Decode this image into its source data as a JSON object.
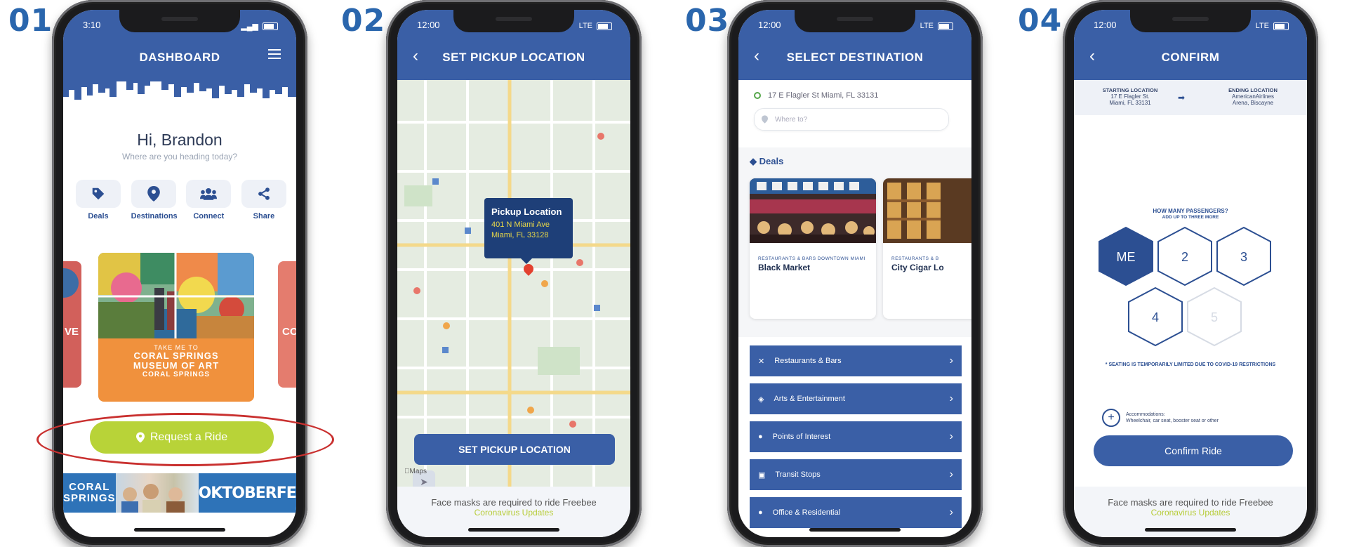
{
  "steps": [
    "01",
    "02",
    "03",
    "04"
  ],
  "phone1": {
    "time": "3:10",
    "title": "DASHBOARD",
    "greeting": "Hi, Brandon",
    "subtitle": "Where are you heading today?",
    "quick_actions": [
      {
        "label": "Deals",
        "icon": "tag-icon"
      },
      {
        "label": "Destinations",
        "icon": "location-pin-icon"
      },
      {
        "label": "Connect",
        "icon": "people-icon"
      },
      {
        "label": "Share",
        "icon": "share-icon"
      }
    ],
    "card": {
      "line1": "TAKE ME TO",
      "line2": "CORAL SPRINGS",
      "line3": "MUSEUM OF ART",
      "line4": "CORAL SPRINGS"
    },
    "left_peek": "VE",
    "right_peek": "CO",
    "request_button": "Request a Ride",
    "banner": {
      "left": "CORAL\nSPRINGS",
      "right": "OKTOBERFEST"
    }
  },
  "phone2": {
    "time": "12:00",
    "signal": "LTE",
    "title": "SET PICKUP LOCATION",
    "callout_title": "Pickup Location",
    "callout_line1": "401 N Miami Ave",
    "callout_line2": "Miami, FL 33128",
    "pickup_button": "SET PICKUP LOCATION",
    "maps_label": "Maps",
    "footer_line1": "Face masks are required to ride Freebee",
    "footer_line2": "Coronavirus Updates"
  },
  "phone3": {
    "time": "12:00",
    "signal": "LTE",
    "title": "SELECT DESTINATION",
    "from": "17 E Flagler St  Miami, FL 33131",
    "where_placeholder": "Where to?",
    "deals_title": "Deals",
    "deals": [
      {
        "tag": "RESTAURANTS & BARS    DOWNTOWN MIAMI",
        "name": "Black Market"
      },
      {
        "tag": "RESTAURANTS & B",
        "name": "City Cigar Lo"
      }
    ],
    "categories": [
      {
        "label": "Restaurants & Bars",
        "icon": "fork-knife-icon"
      },
      {
        "label": "Arts & Entertainment",
        "icon": "ticket-icon"
      },
      {
        "label": "Points of Interest",
        "icon": "location-pin-icon"
      },
      {
        "label": "Transit Stops",
        "icon": "bus-icon"
      },
      {
        "label": "Office & Residential",
        "icon": "location-pin-icon"
      }
    ]
  },
  "phone4": {
    "time": "12:00",
    "signal": "LTE",
    "title": "CONFIRM",
    "start_label": "STARTING LOCATION",
    "start_line1": "17 E Flagler St.",
    "start_line2": "Miami, FL 33131",
    "end_label": "ENDING LOCATION",
    "end_line1": "AmericanAirlines",
    "end_line2": "Arena, Biscayne",
    "pass_title": "HOW MANY PASSENGERS?",
    "pass_sub": "ADD UP TO THREE MORE",
    "passengers": [
      "ME",
      "2",
      "3",
      "4",
      "5"
    ],
    "covid_note": "* SEATING IS TEMPORARILY LIMITED DUE TO COVID-19 RESTRICTIONS",
    "accom_title": "Accommodations:",
    "accom_sub": "Wheelchair, car seat, booster seat or other",
    "confirm_button": "Confirm Ride",
    "footer_line1": "Face masks are required to ride Freebee",
    "footer_line2": "Coronavirus Updates"
  },
  "colors": {
    "header": "#3a5fa6",
    "accent_green": "#b8d338",
    "step": "#2a66ad",
    "highlight_ring": "#c9302f"
  }
}
